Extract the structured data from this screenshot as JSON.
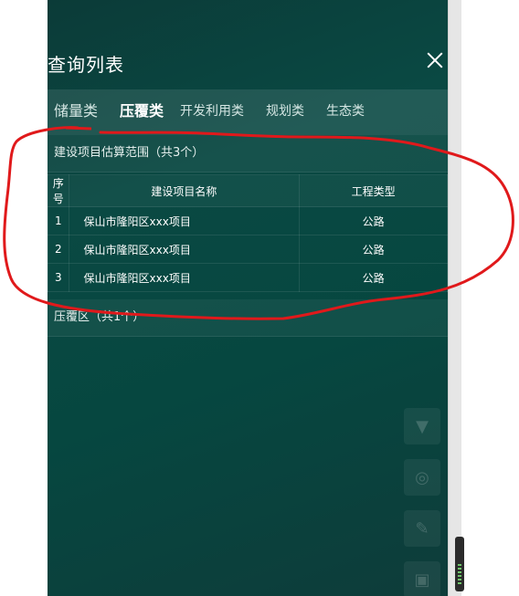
{
  "panel": {
    "title": "查询列表",
    "tabs": [
      {
        "label": "储量类",
        "active": false
      },
      {
        "label": "压覆类",
        "active": true
      },
      {
        "label": "开发利用类",
        "active": false
      },
      {
        "label": "规划类",
        "active": false
      },
      {
        "label": "生态类",
        "active": false
      }
    ],
    "section1": {
      "header": "建设项目估算范围（共3个）",
      "columns": [
        "序号",
        "建设项目名称",
        "工程类型"
      ],
      "rows": [
        {
          "index": "1",
          "name": "保山市隆阳区xxx项目",
          "type": "公路"
        },
        {
          "index": "2",
          "name": "保山市隆阳区xxx项目",
          "type": "公路"
        },
        {
          "index": "3",
          "name": "保山市隆阳区xxx项目",
          "type": "公路"
        }
      ]
    },
    "section2": {
      "header": "压覆区（共1个）"
    }
  },
  "tools": [
    {
      "icon": "filter-icon"
    },
    {
      "icon": "target-icon"
    },
    {
      "icon": "pencil-icon"
    },
    {
      "icon": "frame-icon"
    }
  ],
  "colors": {
    "panel_bg": "#0a4943",
    "annotation": "#e0191b"
  }
}
